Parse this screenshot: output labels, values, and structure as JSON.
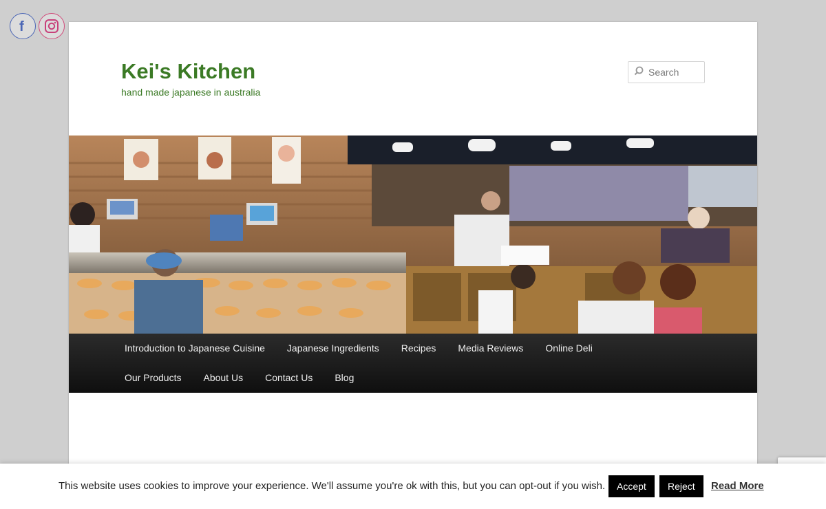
{
  "social": [
    {
      "name": "facebook",
      "icon": "facebook-icon",
      "color": "#4b66b5"
    },
    {
      "name": "instagram",
      "icon": "instagram-icon",
      "color": "#d14a7a"
    }
  ],
  "site": {
    "title": "Kei's Kitchen",
    "tagline": "hand made japanese in australia",
    "title_color": "#3b7a25"
  },
  "search": {
    "placeholder": "Search",
    "icon": "search-icon"
  },
  "banner": {
    "description_icon": "bakery-shop-photo"
  },
  "nav": {
    "items": [
      {
        "label": "Introduction to Japanese Cuisine"
      },
      {
        "label": "Japanese Ingredients"
      },
      {
        "label": "Recipes"
      },
      {
        "label": "Media Reviews"
      },
      {
        "label": "Online Deli"
      },
      {
        "label": "Our Products"
      },
      {
        "label": "About Us"
      },
      {
        "label": "Contact Us"
      },
      {
        "label": "Blog"
      }
    ]
  },
  "cookie": {
    "message": "This website uses cookies to improve your experience. We'll assume you're ok with this, but you can opt-out if you wish.",
    "accept_label": "Accept",
    "reject_label": "Reject",
    "read_more_label": "Read More"
  }
}
